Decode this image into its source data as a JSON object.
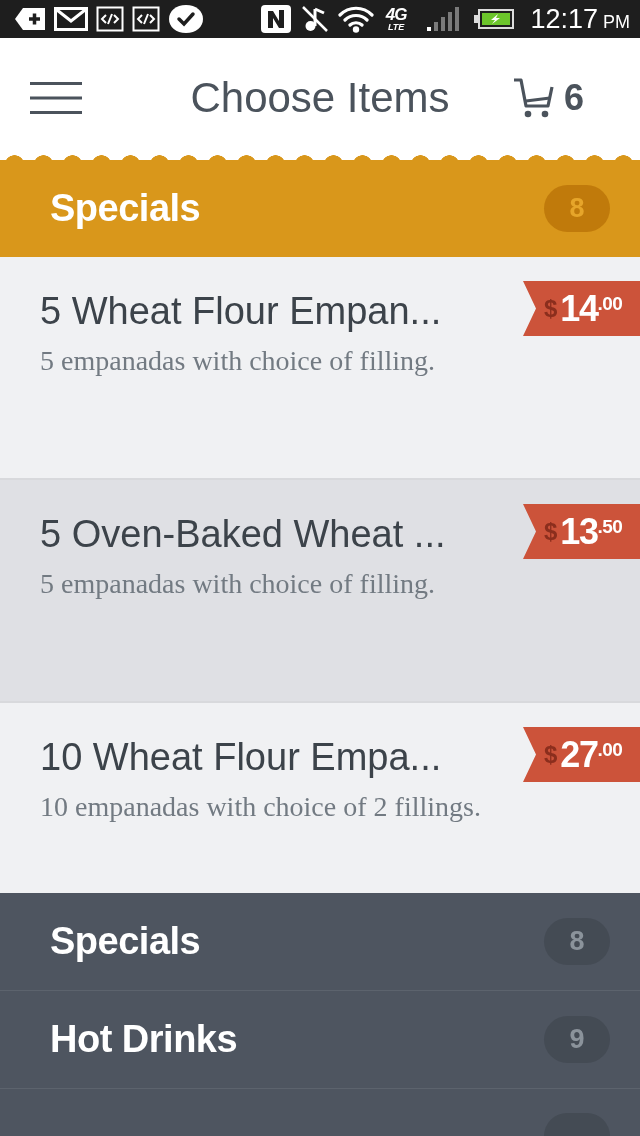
{
  "status_bar": {
    "network": "4G",
    "network_detail": "LTE",
    "time": "12:17",
    "meridiem": "PM"
  },
  "header": {
    "title": "Choose Items",
    "cart_count": "6"
  },
  "current_category": {
    "label": "Specials",
    "count": "8"
  },
  "items": [
    {
      "name": "5 Wheat Flour Empan...",
      "description": "5 empanadas with choice of filling.",
      "price": {
        "currency": "$",
        "whole": "14",
        "cents": ".00"
      },
      "selected": false
    },
    {
      "name": "5 Oven-Baked Wheat ...",
      "description": "5 empanadas with choice of filling.",
      "price": {
        "currency": "$",
        "whole": "13",
        "cents": ".50"
      },
      "selected": true
    },
    {
      "name": "10 Wheat Flour Empa...",
      "description": "10 empanadas with choice of 2 fillings.",
      "price": {
        "currency": "$",
        "whole": "27",
        "cents": ".00"
      },
      "selected": false
    }
  ],
  "categories": [
    {
      "kind": "category",
      "label": "Specials",
      "count": "8"
    },
    {
      "kind": "category",
      "label": "Hot Drinks",
      "count": "9"
    },
    {
      "kind": "cut_off"
    }
  ]
}
